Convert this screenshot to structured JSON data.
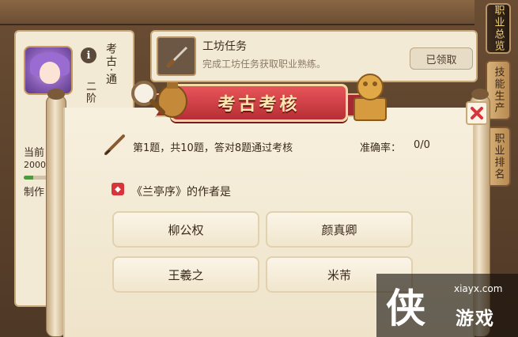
{
  "background": {
    "left_panel": {
      "career_name": "考古·通",
      "rank": "二阶",
      "current_label": "当前",
      "progress_value": "2000",
      "craft_label": "制作",
      "progress_fraction": 0.2
    },
    "task": {
      "title": "工坊任务",
      "description": "完成工坊任务获取职业熟练。",
      "button_label": "已领取"
    },
    "side_tabs": [
      {
        "label": "职业总览",
        "active": true
      },
      {
        "label": "技能生产",
        "active": false
      },
      {
        "label": "职业排名",
        "active": false
      }
    ]
  },
  "quiz": {
    "title": "考古考核",
    "progress_text": "第1题，共10题，答对8题通过考核",
    "accuracy_label": "准确率：",
    "accuracy_value": "0/0",
    "question": "《兰亭序》的作者是",
    "options": [
      "柳公权",
      "颜真卿",
      "王羲之",
      "米芾"
    ]
  },
  "watermark": {
    "glyph": "侠",
    "domain": "xiayx.com",
    "name": "游戏"
  },
  "colors": {
    "banner_red": "#c7383e",
    "parchment": "#f3ead6",
    "close_red": "#d8353b",
    "text_brown": "#3b2a1c"
  }
}
